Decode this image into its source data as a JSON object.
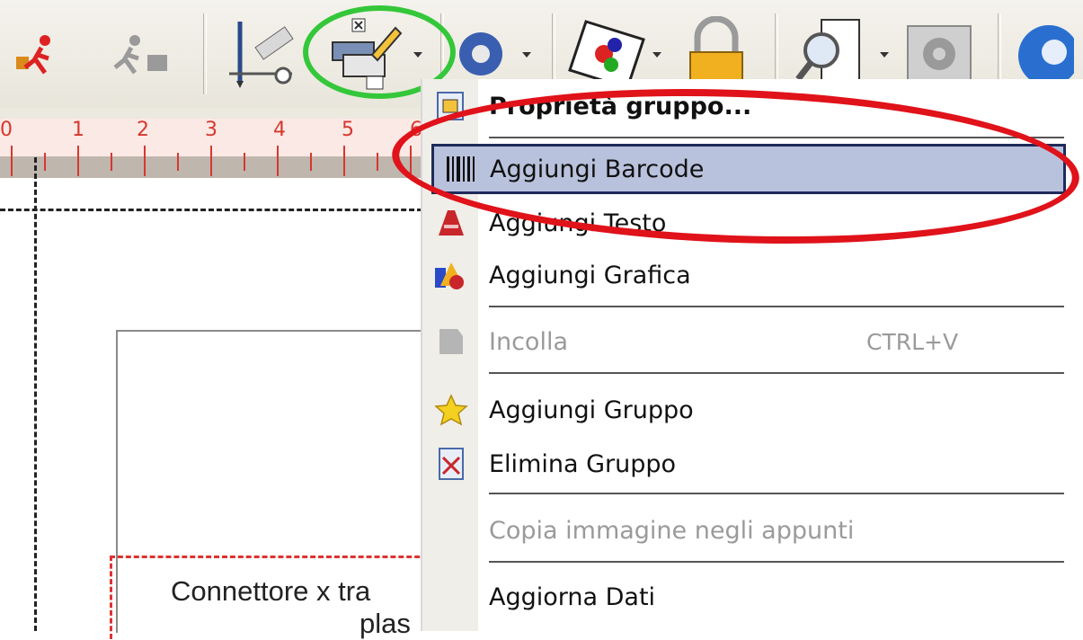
{
  "toolbar": {
    "buttons": [
      {
        "icon": "run-icon"
      },
      {
        "icon": "run-disabled-icon"
      },
      {
        "icon": "design-tools-icon"
      },
      {
        "icon": "group-properties-icon"
      },
      {
        "icon": "gear-dropdown-icon"
      },
      {
        "icon": "image-icon"
      },
      {
        "icon": "lock-icon"
      },
      {
        "icon": "preview-icon"
      },
      {
        "icon": "settings-icon"
      },
      {
        "icon": "help-icon"
      }
    ]
  },
  "ruler": {
    "numbers": [
      "0",
      "1",
      "2",
      "3",
      "4",
      "5",
      "6"
    ]
  },
  "canvas": {
    "text_line1": "Connettore x tra",
    "text_line2": "plas"
  },
  "menu": {
    "items": [
      {
        "label": "Proprietà gruppo...",
        "icon": "group-properties-icon",
        "bold": true
      },
      {
        "label": "Aggiungi Barcode",
        "icon": "barcode-icon",
        "highlighted": true
      },
      {
        "label": "Aggiungi Testo",
        "icon": "text-icon"
      },
      {
        "label": "Aggiungi Grafica",
        "icon": "graphic-shapes-icon"
      },
      {
        "label": "Incolla",
        "icon": "paste-icon",
        "shortcut": "CTRL+V",
        "disabled": true
      },
      {
        "label": "Aggiungi Gruppo",
        "icon": "star-icon"
      },
      {
        "label": "Elimina Gruppo",
        "icon": "delete-group-icon"
      },
      {
        "label": "Copia immagine negli appunti",
        "disabled": true
      },
      {
        "label": "Aggiorna Dati"
      }
    ]
  },
  "annotations": {
    "green_circle_color": "#34c73a",
    "red_ellipse_color": "#e0121a",
    "highlight_color": "#b9c2dc"
  }
}
